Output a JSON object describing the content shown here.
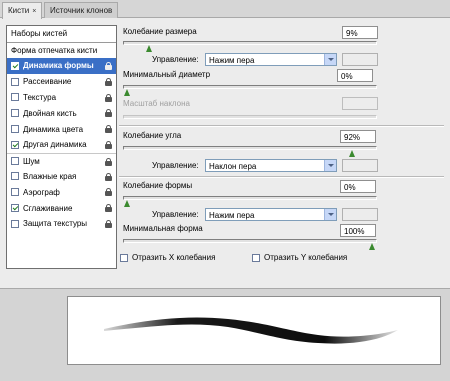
{
  "tabs": [
    {
      "label": "Кисти",
      "close": "×"
    },
    {
      "label": "Источник клонов"
    }
  ],
  "sidebar": {
    "presets_label": "Наборы кистей",
    "tip_shape_label": "Форма отпечатка кисти",
    "items": [
      {
        "label": "Динамика формы",
        "checked": true,
        "selected": true,
        "locked": true
      },
      {
        "label": "Рассеивание",
        "checked": false,
        "locked": true
      },
      {
        "label": "Текстура",
        "checked": false,
        "locked": true
      },
      {
        "label": "Двойная кисть",
        "checked": false,
        "locked": true
      },
      {
        "label": "Динамика цвета",
        "checked": false,
        "locked": true
      },
      {
        "label": "Другая динамика",
        "checked": true,
        "locked": true
      },
      {
        "label": "Шум",
        "checked": false,
        "locked": true
      },
      {
        "label": "Влажные края",
        "checked": false,
        "locked": true
      },
      {
        "label": "Аэрограф",
        "checked": false,
        "locked": true
      },
      {
        "label": "Сглаживание",
        "checked": true,
        "locked": true
      },
      {
        "label": "Защита текстуры",
        "checked": false,
        "locked": true
      }
    ]
  },
  "size_jitter": {
    "label": "Колебание размера",
    "value": "9%",
    "level": 0.09,
    "control_label": "Управление:",
    "control_value": "Нажим пера"
  },
  "min_diameter": {
    "label": "Минимальный диаметр",
    "value": "0%",
    "level": 0.0
  },
  "tilt_scale": {
    "label": "Масштаб наклона",
    "value": "",
    "disabled": true
  },
  "angle_jitter": {
    "label": "Колебание угла",
    "value": "92%",
    "level": 0.92,
    "control_label": "Управление:",
    "control_value": "Наклон пера"
  },
  "roundness_jitter": {
    "label": "Колебание формы",
    "value": "0%",
    "level": 0.0,
    "control_label": "Управление:",
    "control_value": "Нажим пера"
  },
  "min_roundness": {
    "label": "Минимальная форма",
    "value": "100%",
    "level": 1.0
  },
  "flip_x": {
    "label": "Отразить X колебания",
    "checked": false
  },
  "flip_y": {
    "label": "Отразить Y колебания",
    "checked": false
  },
  "colors": {
    "selected": "#3a6fc6",
    "thumb": "#3b8a2f"
  }
}
